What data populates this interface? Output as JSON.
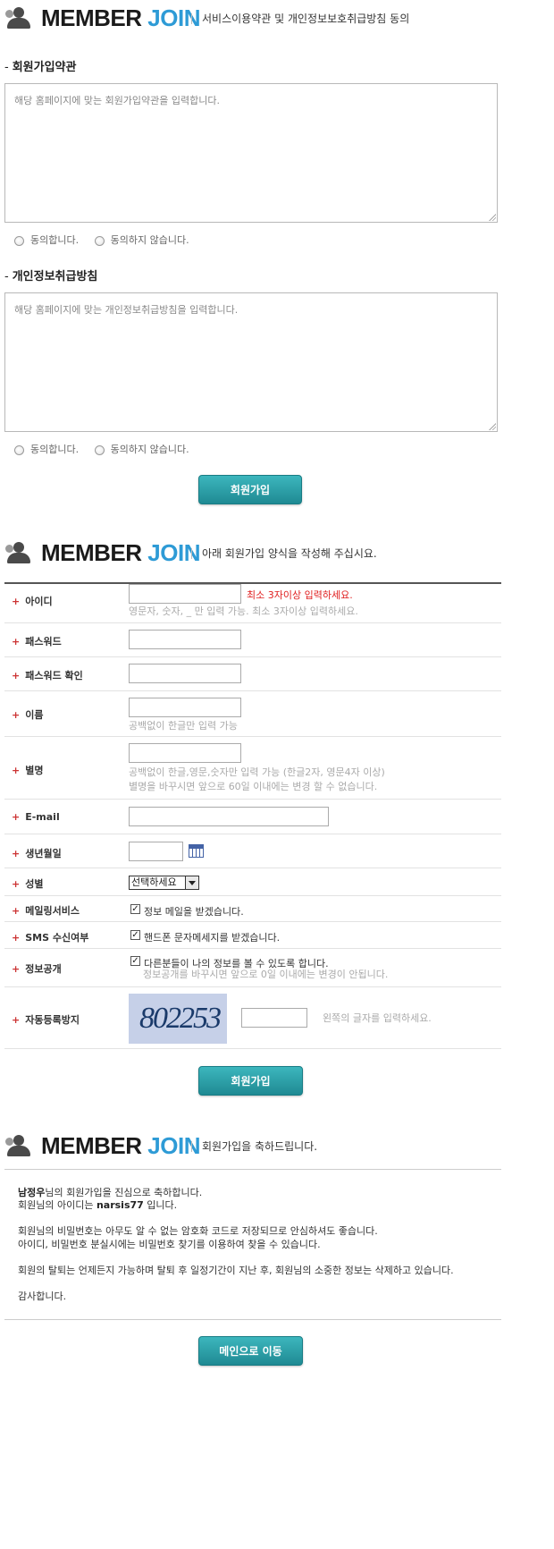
{
  "header": {
    "title_member": "MEMBER",
    "title_join": "JOIN",
    "desc_agree": "서비스이용약관 및 개인정보보호취급방침 동의",
    "desc_form": "아래 회원가입 양식을 작성해 주십시요.",
    "desc_done": "회원가입을 축하드립니다."
  },
  "agreement": {
    "terms_title": "회원가입약관",
    "terms_placeholder": "해당 홈페이지에 맞는 회원가입약관을 입력합니다.",
    "privacy_title": "개인정보취급방침",
    "privacy_placeholder": "해당 홈페이지에 맞는 개인정보취급방침을 입력합니다.",
    "agree": "동의합니다.",
    "disagree": "동의하지 않습니다.",
    "submit": "회원가입"
  },
  "form": {
    "id_label": "아이디",
    "id_warn": "최소 3자이상 입력하세요.",
    "id_hint": "영문자, 숫자, _ 만 입력 가능. 최소 3자이상 입력하세요.",
    "pw_label": "패스워드",
    "pw_confirm_label": "패스워드 확인",
    "name_label": "이름",
    "name_hint": "공백없이 한글만 입력 가능",
    "nick_label": "별명",
    "nick_hint1": "공백없이 한글,영문,숫자만 입력 가능 (한글2자, 영문4자 이상)",
    "nick_hint2": "별명을 바꾸시면 앞으로 60일 이내에는 변경 할 수 없습니다.",
    "email_label": "E-mail",
    "birth_label": "생년월일",
    "gender_label": "성별",
    "gender_selected": "선택하세요",
    "mailing_label": "메일링서비스",
    "mailing_text": "정보 메일을 받겠습니다.",
    "sms_label": "SMS 수신여부",
    "sms_text": "핸드폰 문자메세지를 받겠습니다.",
    "open_label": "정보공개",
    "open_text": "다른분들이 나의 정보를 볼 수 있도록 합니다.",
    "open_hint": "정보공개를 바꾸시면 앞으로 0일 이내에는 변경이 안됩니다.",
    "captcha_label": "자동등록방지",
    "captcha_code": "802253",
    "captcha_hint": "왼쪽의 글자를 입력하세요.",
    "submit": "회원가입"
  },
  "done": {
    "name": "남정우",
    "line1_rest": "님의 회원가입을 진심으로 축하합니다.",
    "line2_pre": "회원님의 아이디는 ",
    "user_id": "narsis77",
    "line2_post": " 입니다.",
    "line3": "회원님의 비밀번호는 아무도 알 수 없는 암호화 코드로 저장되므로 안심하셔도 좋습니다.",
    "line4": "아이디, 비밀번호 분실시에는 비밀번호 찾기를 이용하여 찾을 수 있습니다.",
    "line5": "회원의 탈퇴는 언제든지 가능하며 탈퇴 후 일정기간이 지난 후, 회원님의 소중한 정보는 삭제하고 있습니다.",
    "line6": "감사합니다.",
    "main_button": "메인으로 이동"
  },
  "colors": {
    "accent_blue": "#2e9bd6",
    "button_teal": "#2aa3ab",
    "warn_red": "#e02020"
  }
}
